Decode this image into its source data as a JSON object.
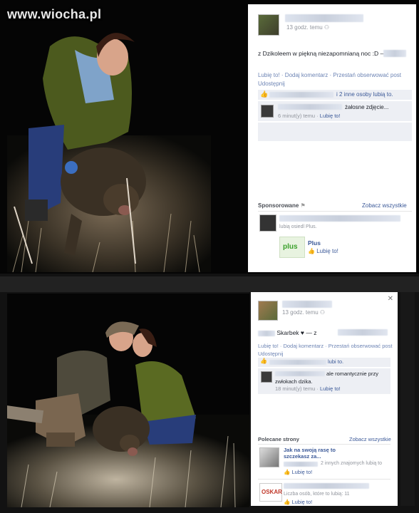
{
  "watermark": "www.wiocha.pl",
  "top_post": {
    "time": "13 godz. temu",
    "text": "z Dzikoleem w piękną niezapomnianą noc :D — z",
    "actions_line1": "Lubię to! · Dodaj komentarz · Przestań obserwować post",
    "actions_line2": "Udostępnij",
    "likes_text": "i 2 inne osoby lubią to.",
    "comment": {
      "text": "żałosne zdjęcie...",
      "time": "6 minut(y) temu ·",
      "like": "Lubię to!"
    },
    "sponsored": {
      "title": "Sponsorowane",
      "see_all": "Zobacz wszystkie",
      "liked_by": "lubią osiedl Plus.",
      "brand": "Plus",
      "like_button": "Lubię to!"
    }
  },
  "bottom_post": {
    "time": "13 godz. temu",
    "text": "Skarbek ♥ — z",
    "actions_line1": "Lubię to! · Dodaj komentarz · Przestań obserwować post",
    "actions_line2": "Udostępnij",
    "likes_text": "lubi to.",
    "comment": {
      "text_line1": "ale romantycznie przy",
      "text_line2": "zwłokach dzika.",
      "time": "18 minut(y) temu ·",
      "like": "Lubię to!"
    },
    "recommended": {
      "title": "Polecane strony",
      "see_all": "Zobacz wszystkie",
      "page1_title_line1": "Jak na swoją rasę to",
      "page1_title_line2": "szczekasz za...",
      "page1_friends": "2 innych znajomych lubią to",
      "page1_like": "Lubię to!",
      "page2_logo": "OSKAR",
      "page2_count": "Liczba osób, które to lubią: 11",
      "page2_like": "Lubię to!"
    }
  },
  "colors": {
    "fb_blue": "#3b5998",
    "fb_gray": "#90949c",
    "fb_bg": "#edeff4"
  }
}
